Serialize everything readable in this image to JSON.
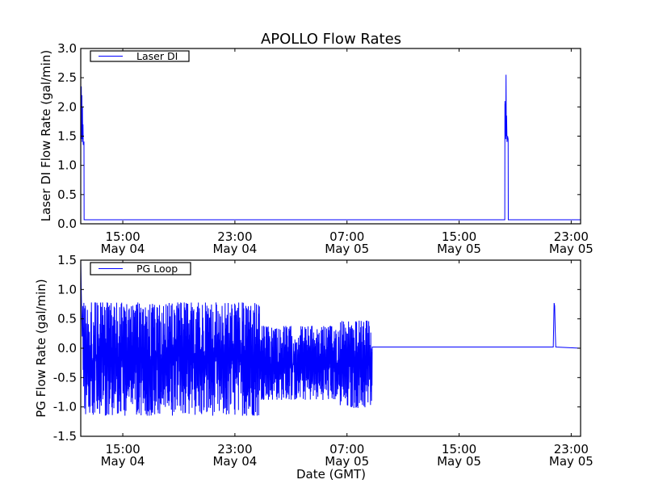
{
  "chart_data": [
    {
      "type": "line",
      "title": "APOLLO Flow Rates",
      "xlabel": "",
      "ylabel": "Laser DI Flow Rate (gal/min)",
      "x_units": "hours since May 04 12:00 GMT",
      "xlim": [
        0,
        35.67
      ],
      "ylim": [
        0.0,
        3.0
      ],
      "yticks": [
        "0.0",
        "0.5",
        "1.0",
        "1.5",
        "2.0",
        "2.5",
        "3.0"
      ],
      "ytick_values": [
        0,
        0.5,
        1,
        1.5,
        2,
        2.5,
        3
      ],
      "xticks": [
        {
          "value": 3,
          "time": "15:00",
          "date": "May 04"
        },
        {
          "value": 11,
          "time": "23:00",
          "date": "May 04"
        },
        {
          "value": 19,
          "time": "07:00",
          "date": "May 05"
        },
        {
          "value": 27,
          "time": "15:00",
          "date": "May 05"
        },
        {
          "value": 35,
          "time": "23:00",
          "date": "May 05"
        }
      ],
      "legend": {
        "label": "Laser DI",
        "placement": "top-left"
      },
      "color": "#0000ff",
      "series": [
        {
          "name": "Laser DI",
          "x": [
            0,
            0.02,
            0.04,
            0.06,
            0.08,
            0.1,
            0.12,
            0.14,
            0.16,
            0.18,
            0.2,
            0.23,
            0.24,
            30.26,
            30.27,
            30.29,
            30.31,
            30.33,
            30.35,
            30.37,
            30.39,
            30.42,
            30.46,
            30.5,
            30.51,
            35.67
          ],
          "y": [
            2.4,
            1.5,
            2.35,
            1.45,
            2.2,
            1.4,
            2.0,
            1.45,
            1.7,
            1.35,
            1.4,
            1.4,
            0.07,
            0.07,
            2.1,
            1.6,
            2.05,
            1.45,
            2.55,
            1.5,
            1.85,
            1.4,
            1.5,
            1.45,
            0.07,
            0.07
          ]
        }
      ]
    },
    {
      "type": "line",
      "title": "",
      "xlabel": "Date (GMT)",
      "ylabel": "PG Flow Rate (gal/min)",
      "x_units": "hours since May 04 12:00 GMT",
      "xlim": [
        0,
        35.67
      ],
      "ylim": [
        -1.5,
        1.5
      ],
      "yticks": [
        "-1.5",
        "-1.0",
        "-0.5",
        "0.0",
        "0.5",
        "1.0",
        "1.5"
      ],
      "ytick_values": [
        -1.5,
        -1,
        -0.5,
        0,
        0.5,
        1,
        1.5
      ],
      "xticks": [
        {
          "value": 3,
          "time": "15:00",
          "date": "May 04"
        },
        {
          "value": 11,
          "time": "23:00",
          "date": "May 04"
        },
        {
          "value": 19,
          "time": "07:00",
          "date": "May 05"
        },
        {
          "value": 27,
          "time": "15:00",
          "date": "May 05"
        },
        {
          "value": 35,
          "time": "23:00",
          "date": "May 05"
        }
      ],
      "legend": {
        "label": "PG Loop",
        "placement": "top-left"
      },
      "color": "#0000ff",
      "series": [
        {
          "name": "PG Loop",
          "x": [
            0,
            0.05,
            0.1,
            20.8,
            33.72,
            33.78,
            33.82,
            33.86,
            33.9,
            35.67
          ],
          "y": [
            1.5,
            0.8,
            0.2,
            0.02,
            0.02,
            0.77,
            0.72,
            0.3,
            0.02,
            0.0
          ],
          "oscillation_segments": [
            {
              "x_start": 0.15,
              "x_end": 12.8,
              "min": -1.15,
              "max": 0.78
            },
            {
              "x_start": 12.8,
              "x_end": 18.5,
              "min": -0.88,
              "max": 0.38
            },
            {
              "x_start": 18.5,
              "x_end": 20.8,
              "min": -1.02,
              "max": 0.47
            }
          ]
        }
      ]
    }
  ]
}
